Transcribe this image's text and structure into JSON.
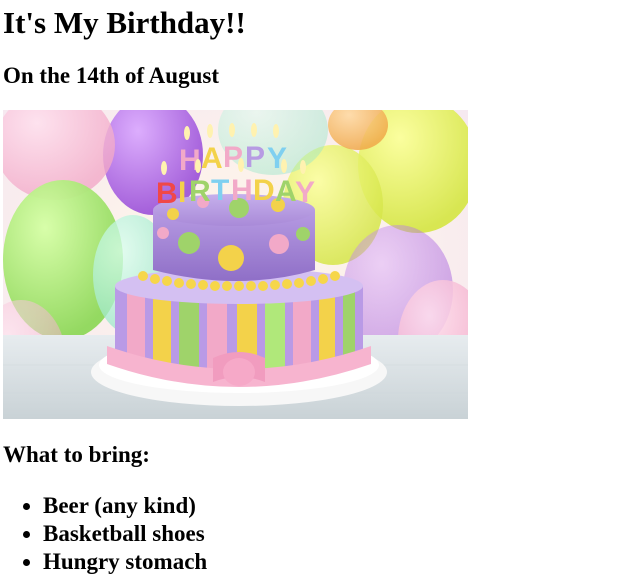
{
  "page": {
    "title": "It's My Birthday!!",
    "date_line": "On the 14th of August",
    "hero_image": {
      "name": "birthday-cake-image",
      "cake_lettering": "HAPPY BIRTHDAY"
    },
    "bring_heading": "What to bring:",
    "bring_items": [
      "Beer (any kind)",
      "Basketball shoes",
      "Hungry stomach"
    ]
  },
  "colors": {
    "text": "#000000",
    "background": "#ffffff",
    "cake_purple": "#a98ad8",
    "cake_yellow": "#f3d24a",
    "cake_pink": "#f2a9c8",
    "cake_green": "#9fd36a"
  }
}
